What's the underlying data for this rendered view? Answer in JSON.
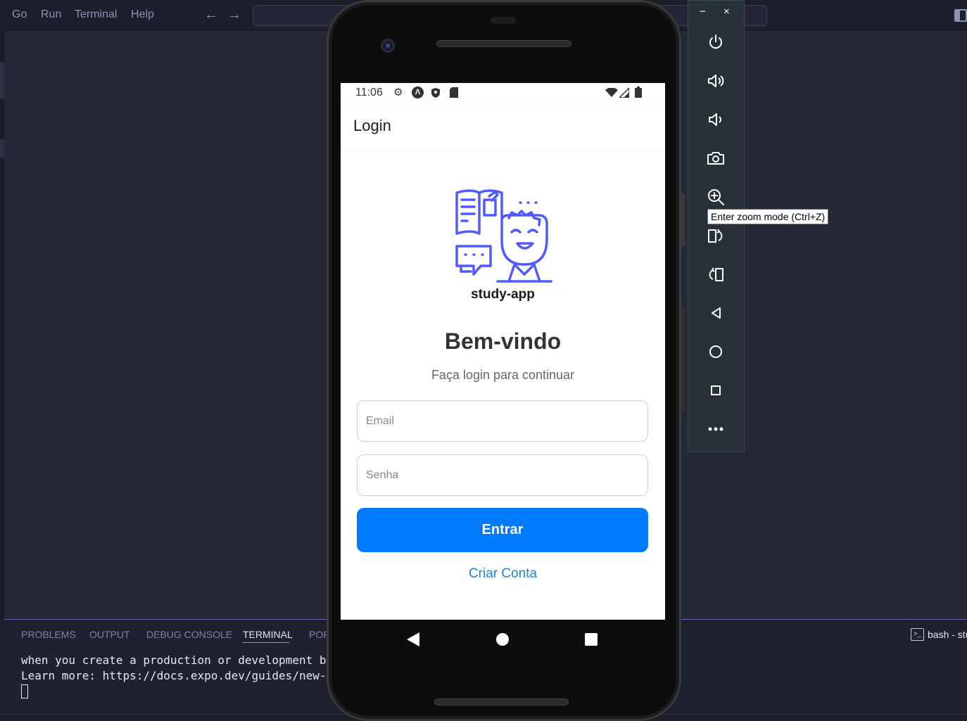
{
  "vscode": {
    "menu": [
      "Go",
      "Run",
      "Terminal",
      "Help"
    ],
    "nav_back": "←",
    "nav_forward": "→",
    "panel_tabs": [
      "PROBLEMS",
      "OUTPUT",
      "DEBUG CONSOLE",
      "TERMINAL",
      "POR"
    ],
    "active_tab": "TERMINAL",
    "terminal_instance": "bash - stu",
    "terminal_lines": [
      "when you create a production or development buil",
      "Learn more: https://docs.expo.dev/guides/new-arcl"
    ]
  },
  "emulator": {
    "window_minimize": "−",
    "window_close": "×",
    "tooltip": "Enter zoom mode (Ctrl+Z)",
    "toolbar_icons": [
      "power-icon",
      "volume-up-icon",
      "volume-down-icon",
      "camera-icon",
      "zoom-icon",
      "rotate-left-icon",
      "rotate-right-icon",
      "back-icon",
      "home-icon",
      "overview-icon",
      "more-icon"
    ]
  },
  "phone": {
    "status_time": "11:06",
    "header_title": "Login",
    "logo_text": "study-app",
    "welcome": "Bem-vindo",
    "subtitle": "Faça login para continuar",
    "email_placeholder": "Email",
    "password_placeholder": "Senha",
    "login_button": "Entrar",
    "create_account": "Criar Conta",
    "colors": {
      "primary_button": "#007bff",
      "link": "#1a86d8",
      "logo": "#4f5bff"
    }
  }
}
